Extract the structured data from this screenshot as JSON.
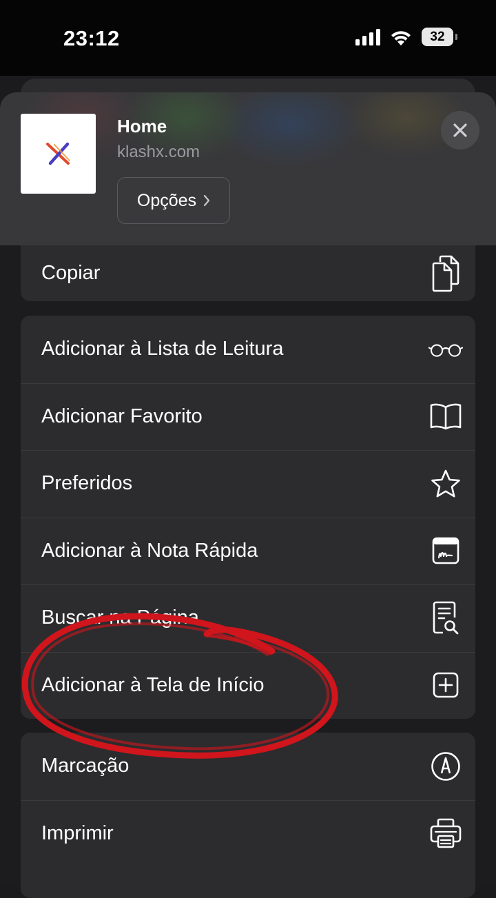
{
  "status_bar": {
    "time": "23:12",
    "battery_level": "32"
  },
  "header": {
    "title": "Home",
    "url": "klashx.com",
    "options_label": "Opções",
    "favicon_icon": "klashx-logo"
  },
  "groups": [
    {
      "items": [
        {
          "label": "Copiar",
          "icon": "copy-icon"
        }
      ]
    },
    {
      "items": [
        {
          "label": "Adicionar à Lista de Leitura",
          "icon": "glasses-icon"
        },
        {
          "label": "Adicionar Favorito",
          "icon": "book-icon"
        },
        {
          "label": "Preferidos",
          "icon": "star-icon"
        },
        {
          "label": "Adicionar à Nota Rápida",
          "icon": "quick-note-icon"
        },
        {
          "label": "Buscar na Página",
          "icon": "find-in-page-icon"
        },
        {
          "label": "Adicionar à Tela de Início",
          "icon": "add-square-icon"
        }
      ]
    },
    {
      "items": [
        {
          "label": "Marcação",
          "icon": "markup-icon"
        },
        {
          "label": "Imprimir",
          "icon": "print-icon"
        }
      ]
    }
  ],
  "annotation": {
    "color": "#d0151c",
    "shape": "hand-drawn-ellipse"
  }
}
